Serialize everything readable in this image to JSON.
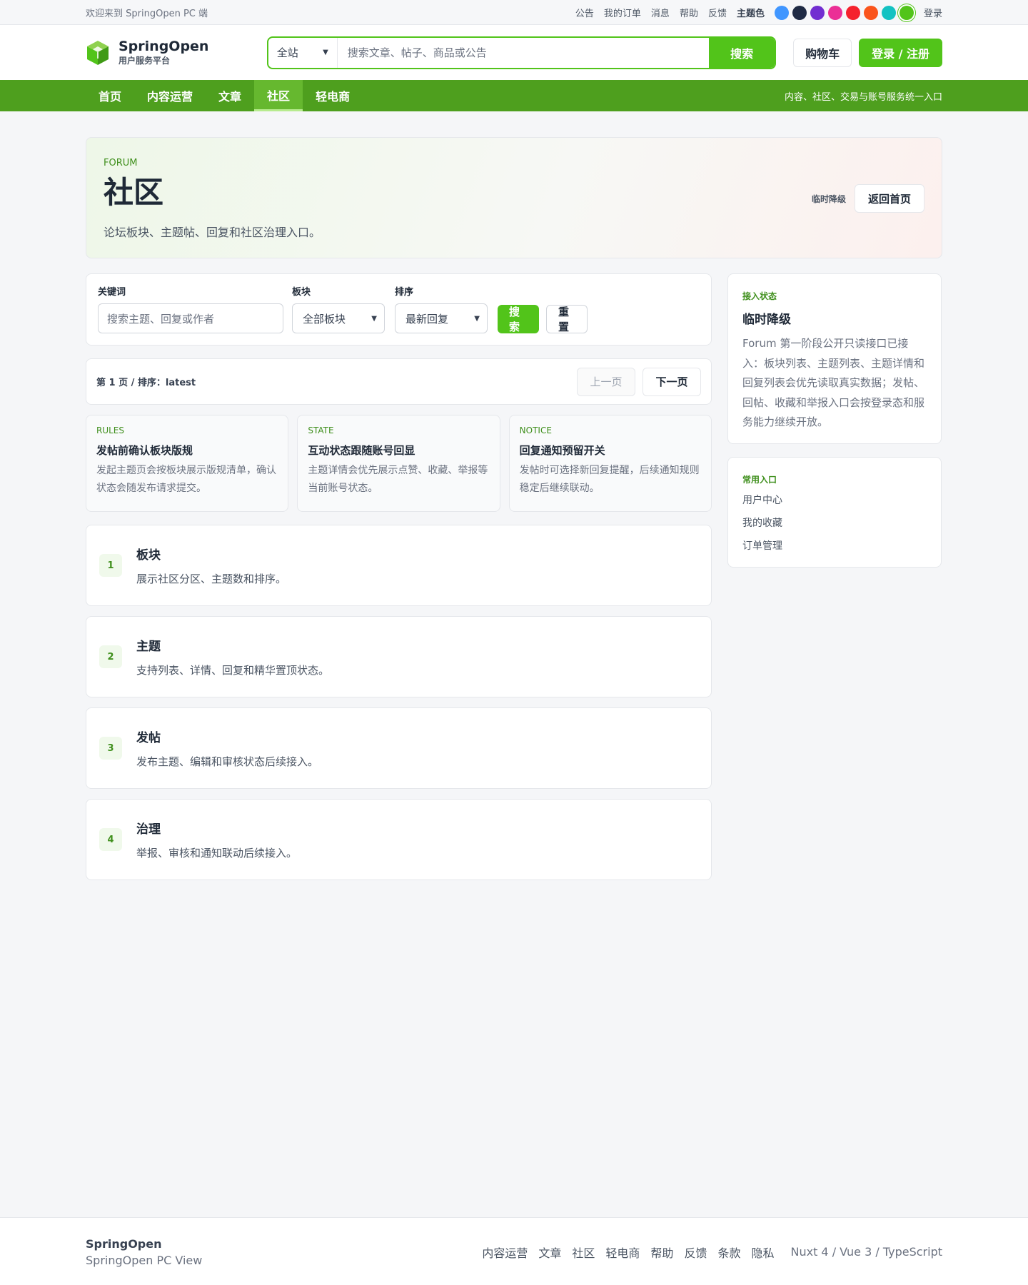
{
  "topbar": {
    "welcome": "欢迎来到 SpringOpen PC 端",
    "links": [
      "公告",
      "我的订单",
      "消息",
      "帮助",
      "反馈"
    ],
    "theme_label": "主题色",
    "swatches": [
      "#4096ff",
      "#1f2a44",
      "#722ed1",
      "#eb2f96",
      "#f5222d",
      "#fa541c",
      "#13c2c2",
      "#52c41a"
    ],
    "login": "登录"
  },
  "header": {
    "logo_title": "SpringOpen",
    "logo_sub": "用户服务平台",
    "search_scope": "全站",
    "search_placeholder": "搜索文章、帖子、商品或公告",
    "search_button": "搜索",
    "cart": "购物车",
    "login_register": "登录 / 注册"
  },
  "nav": {
    "items": [
      "首页",
      "内容运营",
      "文章",
      "社区",
      "轻电商"
    ],
    "active": "社区",
    "slogan": "内容、社区、交易与账号服务统一入口"
  },
  "hero": {
    "eyebrow": "FORUM",
    "title": "社区",
    "desc": "论坛板块、主题帖、回复和社区治理入口。",
    "tag": "临时降级",
    "back_button": "返回首页"
  },
  "filter": {
    "keyword_label": "关键词",
    "keyword_placeholder": "搜索主题、回复或作者",
    "board_label": "板块",
    "board_value": "全部板块",
    "sort_label": "排序",
    "sort_value": "最新回复",
    "search_button": "搜索",
    "reset_button": "重置"
  },
  "pager": {
    "info": "第 1 页 / 排序：latest",
    "prev": "上一页",
    "next": "下一页"
  },
  "notices": [
    {
      "tag": "RULES",
      "title": "发帖前确认板块版规",
      "text": "发起主题页会按板块展示版规清单，确认状态会随发布请求提交。"
    },
    {
      "tag": "STATE",
      "title": "互动状态跟随账号回显",
      "text": "主题详情会优先展示点赞、收藏、举报等当前账号状态。"
    },
    {
      "tag": "NOTICE",
      "title": "回复通知预留开关",
      "text": "发帖时可选择新回复提醒，后续通知规则稳定后继续联动。"
    }
  ],
  "features": [
    {
      "num": "1",
      "title": "板块",
      "desc": "展示社区分区、主题数和排序。"
    },
    {
      "num": "2",
      "title": "主题",
      "desc": "支持列表、详情、回复和精华置顶状态。"
    },
    {
      "num": "3",
      "title": "发帖",
      "desc": "发布主题、编辑和审核状态后续接入。"
    },
    {
      "num": "4",
      "title": "治理",
      "desc": "举报、审核和通知联动后续接入。"
    }
  ],
  "status": {
    "tag": "接入状态",
    "title": "临时降级",
    "text": "Forum 第一阶段公开只读接口已接入：板块列表、主题列表、主题详情和回复列表会优先读取真实数据；发帖、回帖、收藏和举报入口会按登录态和服务能力继续开放。"
  },
  "quick_links": {
    "tag": "常用入口",
    "items": [
      "用户中心",
      "我的收藏",
      "订单管理"
    ]
  },
  "footer": {
    "brand": "SpringOpen",
    "sub": "SpringOpen PC View",
    "links": [
      "内容运营",
      "文章",
      "社区",
      "轻电商",
      "帮助",
      "反馈",
      "条款",
      "隐私"
    ],
    "tech": "Nuxt 4 / Vue 3 / TypeScript"
  }
}
